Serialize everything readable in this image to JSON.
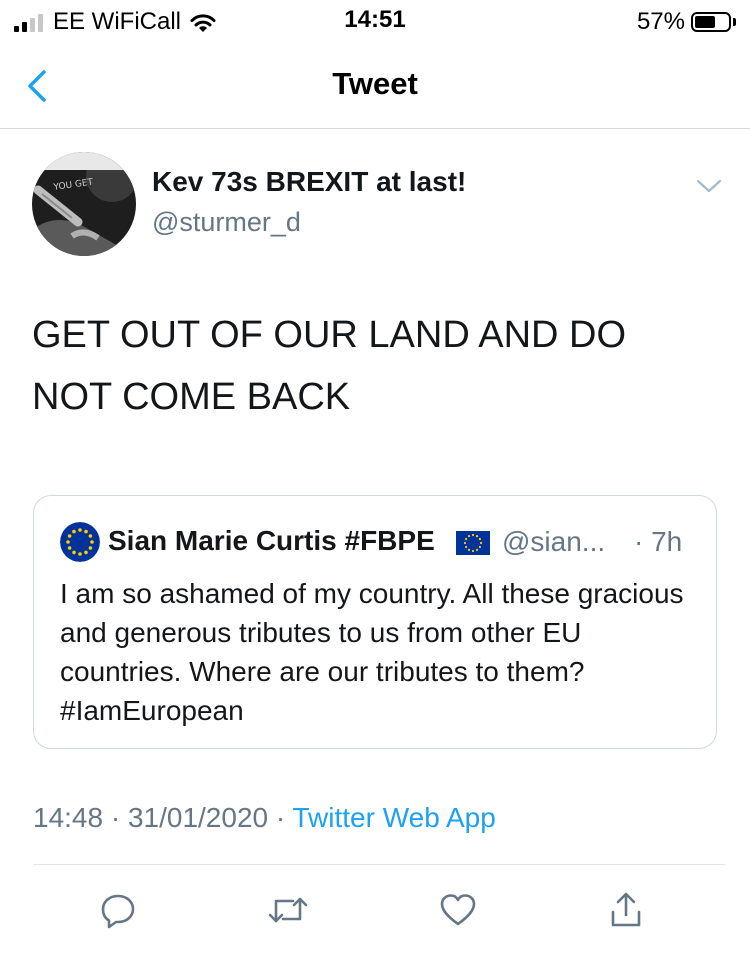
{
  "status_bar": {
    "carrier": "EE WiFiCall",
    "time": "14:51",
    "battery": "57%",
    "battery_level": 0.57
  },
  "nav": {
    "title": "Tweet",
    "back_icon": "chevron-left-icon"
  },
  "tweet": {
    "author_name": "Kev 73s BREXIT at last!",
    "author_handle": "@sturmer_d",
    "text": "GET OUT OF OUR LAND AND DO NOT COME BACK",
    "timestamp": "14:48 · 31/01/2020 · ",
    "source": "Twitter Web App"
  },
  "quoted_tweet": {
    "author_name": "Sian Marie Curtis #FBPE",
    "author_handle": "@sian...",
    "time": "· 7h",
    "text": "I am so ashamed of my country. All these gracious and generous tributes to us from other EU countries. Where are our tributes to them? #IamEuropean"
  },
  "actions": [
    "reply-icon",
    "retweet-icon",
    "like-icon",
    "share-icon"
  ],
  "colors": {
    "link": "#1da1f2",
    "secondary_text": "#657786",
    "primary_text": "#14171a"
  }
}
